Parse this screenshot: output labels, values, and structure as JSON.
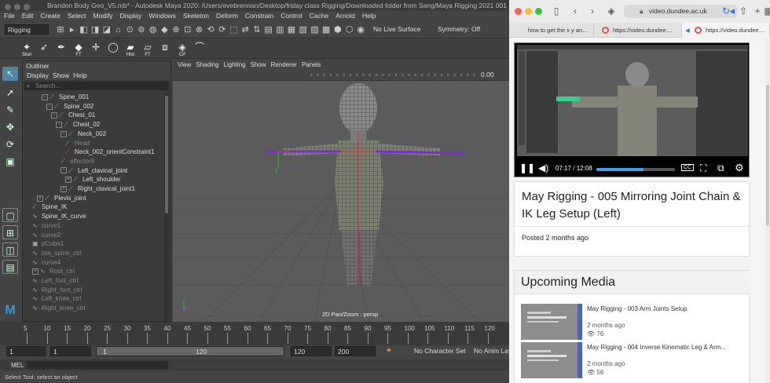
{
  "maya": {
    "window_title": "Brandon Body Geo_V5.mb* - Autodesk Maya 2020: /Users/evebrennan/Desktop/friday class Rigging/Downloaded folder from Sang/Maya Rigging 2021 001",
    "menus": [
      "File",
      "Edit",
      "Create",
      "Select",
      "Modify",
      "Display",
      "Windows",
      "Skeleton",
      "Deform",
      "Constrain",
      "Control",
      "Cache",
      "Arnold",
      "Help"
    ],
    "menuset": "Rigging",
    "live_surface": "No Live Surface",
    "symmetry": "Symmetry: Off",
    "shelf": [
      {
        "icon": "skeleton-joint-icon",
        "label": "Skel"
      },
      {
        "icon": "ik-handle-icon",
        "label": ""
      },
      {
        "icon": "ik-spline-icon",
        "label": ""
      },
      {
        "icon": "freeze-transform-icon",
        "label": "FT"
      },
      {
        "icon": "locator-icon",
        "label": ""
      },
      {
        "icon": "circle-curve-icon",
        "label": ""
      },
      {
        "icon": "history-icon",
        "label": "Hist"
      },
      {
        "icon": "freeze-icon",
        "label": "FT"
      },
      {
        "icon": "parent-constraint-icon",
        "label": ""
      },
      {
        "icon": "center-pivot-icon",
        "label": "CP"
      },
      {
        "icon": "curve-tool-icon",
        "label": ""
      }
    ],
    "outliner": {
      "title": "Outliner",
      "menus": [
        "Display",
        "Show",
        "Help"
      ],
      "search_placeholder": "Search...",
      "items": [
        {
          "label": "Spine_001",
          "indent": 3,
          "type": "joint",
          "exp": "-",
          "dim": false
        },
        {
          "label": "Spine_002",
          "indent": 4,
          "type": "joint",
          "exp": "-",
          "dim": false
        },
        {
          "label": "Chest_01",
          "indent": 5,
          "type": "joint",
          "exp": "-",
          "dim": false
        },
        {
          "label": "Chest_02",
          "indent": 6,
          "type": "joint",
          "exp": "-",
          "dim": false
        },
        {
          "label": "Neck_002",
          "indent": 7,
          "type": "joint",
          "exp": "-",
          "dim": false
        },
        {
          "label": "Head",
          "indent": 8,
          "type": "joint",
          "exp": "",
          "dim": true
        },
        {
          "label": "Neck_002_orientConstraint1",
          "indent": 8,
          "type": "constraint",
          "exp": "",
          "dim": false
        },
        {
          "label": "effector9",
          "indent": 7,
          "type": "effector",
          "exp": "",
          "dim": true
        },
        {
          "label": "Left_clavical_joint",
          "indent": 7,
          "type": "joint",
          "exp": "-",
          "dim": false
        },
        {
          "label": "Left_shoulder",
          "indent": 8,
          "type": "joint",
          "exp": "+",
          "dim": false
        },
        {
          "label": "Right_clavical_joint1",
          "indent": 7,
          "type": "joint",
          "exp": "+",
          "dim": false
        },
        {
          "label": "Plevis_joint",
          "indent": 2,
          "type": "joint",
          "exp": "+",
          "dim": false
        },
        {
          "label": "Spine_IK",
          "indent": 1,
          "type": "ik",
          "exp": "",
          "dim": false
        },
        {
          "label": "Spine_IK_curve",
          "indent": 1,
          "type": "curve",
          "exp": "",
          "dim": false
        },
        {
          "label": "curve1",
          "indent": 1,
          "type": "curve",
          "exp": "",
          "dim": true
        },
        {
          "label": "curve2",
          "indent": 1,
          "type": "curve",
          "exp": "",
          "dim": true
        },
        {
          "label": "pCube1",
          "indent": 1,
          "type": "mesh",
          "exp": "",
          "dim": true
        },
        {
          "label": "low_spine_ctrl",
          "indent": 1,
          "type": "curve",
          "exp": "",
          "dim": true
        },
        {
          "label": "curve4",
          "indent": 1,
          "type": "curve",
          "exp": "",
          "dim": true
        },
        {
          "label": "Root_ctrl",
          "indent": 1,
          "type": "curve",
          "exp": "+",
          "dim": true
        },
        {
          "label": "Left_foot_ctrl",
          "indent": 1,
          "type": "curve",
          "exp": "",
          "dim": true
        },
        {
          "label": "Right_foot_ctrl",
          "indent": 1,
          "type": "curve",
          "exp": "",
          "dim": true
        },
        {
          "label": "Left_knee_ctrl",
          "indent": 1,
          "type": "curve",
          "exp": "",
          "dim": true
        },
        {
          "label": "Right_knee_ctrl",
          "indent": 1,
          "type": "curve",
          "exp": "",
          "dim": true
        }
      ]
    },
    "viewport": {
      "menus": [
        "View",
        "Shading",
        "Lighting",
        "Show",
        "Renderer",
        "Panels"
      ],
      "readout": "0.00",
      "camera_label": "2D Pan/Zoom : persp"
    },
    "timeline_ticks": [
      "5",
      "10",
      "15",
      "20",
      "25",
      "30",
      "35",
      "40",
      "45",
      "50",
      "55",
      "60",
      "65",
      "70",
      "75",
      "80",
      "85",
      "90",
      "95",
      "100",
      "105",
      "110",
      "115",
      "120"
    ],
    "range": {
      "start": "1",
      "anim_start": "1",
      "range_start_field": "1",
      "range_end_field": "120",
      "anim_end": "120",
      "end": "200",
      "character_set": "No Character Set",
      "anim_layer": "No Anim Layer"
    },
    "mel_label": "MEL",
    "help_line": "Select Tool: select an object"
  },
  "browser": {
    "url": "video.dundee.ac.uk",
    "tabs": [
      "how to get the x y an...",
      "https://video.dundee....",
      "https://video.dundee...."
    ],
    "player": {
      "time": "07:17 / 12:08",
      "progress": 0.6,
      "cc": "CC"
    },
    "video_title": "May Rigging - 005 Mirroring Joint Chain & IK Leg Setup (Left)",
    "posted": "Posted 2 months ago",
    "upcoming_title": "Upcoming Media",
    "upcoming": [
      {
        "title": "May Rigging - 003 Arm Joints Setup",
        "date": "2 months ago",
        "views": "76"
      },
      {
        "title": "May Rigging - 004 Inverse Kinematic Leg & Arm...",
        "date": "2 months ago",
        "views": "56"
      }
    ],
    "colors": {
      "accent": "#3aa0e6",
      "close": "#ff5f57",
      "min": "#febc2e",
      "max": "#28c840"
    }
  }
}
